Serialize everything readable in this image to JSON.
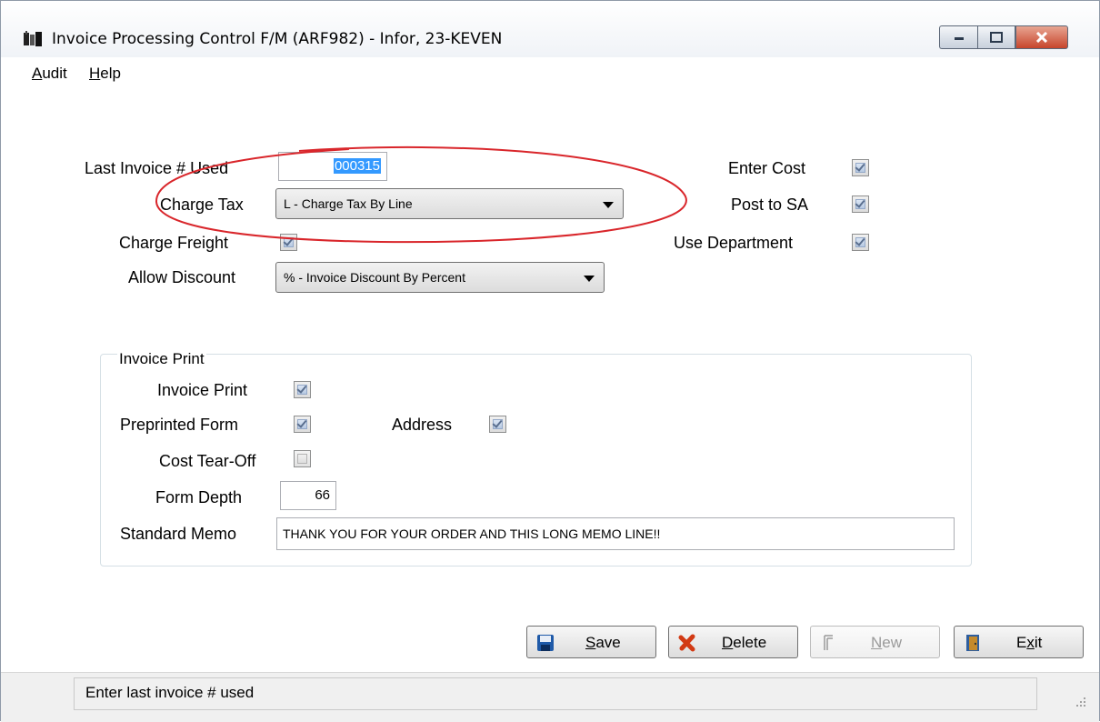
{
  "window": {
    "title": "Invoice Processing Control F/M (ARF982) - Infor, 23-KEVEN",
    "close_color": "#c7452b"
  },
  "menu": {
    "audit": {
      "hotkey": "A",
      "rest": "udit"
    },
    "help": {
      "hotkey": "H",
      "rest": "elp"
    }
  },
  "form": {
    "last_invoice_label": "Last Invoice # Used",
    "last_invoice_value": "000315",
    "charge_tax_label": "Charge Tax",
    "charge_tax_value": "L - Charge Tax By Line",
    "charge_freight_label": "Charge Freight",
    "charge_freight_checked": true,
    "allow_discount_label": "Allow Discount",
    "allow_discount_value": "% - Invoice Discount By Percent",
    "enter_cost_label": "Enter Cost",
    "enter_cost_checked": true,
    "post_to_sa_label": "Post to SA",
    "post_to_sa_checked": true,
    "use_department_label": "Use Department",
    "use_department_checked": true
  },
  "invoice_print": {
    "group_title": "Invoice Print",
    "invoice_print_label": "Invoice Print",
    "invoice_print_checked": true,
    "preprinted_form_label": "Preprinted Form",
    "preprinted_form_checked": true,
    "address_label": "Address",
    "address_checked": true,
    "cost_tear_off_label": "Cost Tear-Off",
    "cost_tear_off_checked": false,
    "form_depth_label": "Form Depth",
    "form_depth_value": "66",
    "standard_memo_label": "Standard Memo",
    "standard_memo_value": "THANK YOU FOR YOUR ORDER AND THIS LONG MEMO LINE!!"
  },
  "buttons": {
    "save": {
      "hotkey": "S",
      "rest": "ave"
    },
    "delete": {
      "hotkey": "D",
      "rest": "elete"
    },
    "new": {
      "hotkey": "N",
      "rest": "ew"
    },
    "exit": {
      "pre": "E",
      "hotkey": "x",
      "rest": "it"
    }
  },
  "status": {
    "message": "Enter last invoice # used"
  },
  "annotation": {
    "color": "#d9262b"
  }
}
